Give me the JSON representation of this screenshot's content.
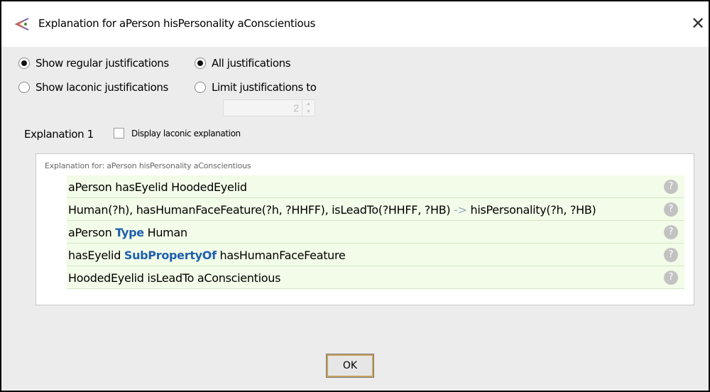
{
  "window": {
    "title": "Explanation for aPerson hisPersonality aConscientious",
    "close_glyph": "✕"
  },
  "options": {
    "show_regular": "Show regular justifications",
    "show_laconic": "Show laconic justifications",
    "all_justifications": "All justifications",
    "limit_justifications": "Limit justifications to",
    "limit_value": "2",
    "selected_mode": "regular",
    "selected_scope": "all"
  },
  "explanation": {
    "label": "Explanation 1",
    "checkbox_label": "Display laconic explanation",
    "checkbox_checked": false,
    "header": "Explanation for: aPerson hisPersonality aConscientious",
    "rows": [
      {
        "pre": "aPerson hasEyelid HoodedEyelid",
        "kw": "",
        "post": ""
      },
      {
        "pre": "Human(?h), hasHumanFaceFeature(?h, ?HHFF), isLeadTo(?HHFF, ?HB) ",
        "arrow": "->",
        "post": " hisPersonality(?h, ?HB)"
      },
      {
        "pre": "aPerson ",
        "kw": "Type",
        "post": " Human"
      },
      {
        "pre": "hasEyelid ",
        "kw": "SubPropertyOf",
        "post": " hasHumanFaceFeature"
      },
      {
        "pre": "HoodedEyelid isLeadTo aConscientious",
        "kw": "",
        "post": ""
      }
    ],
    "help_glyph": "?"
  },
  "buttons": {
    "ok": "OK"
  },
  "colors": {
    "row_bg": "#f2fce8",
    "keyword": "#1f5fb0",
    "help_icon": "#c2c2c2"
  }
}
